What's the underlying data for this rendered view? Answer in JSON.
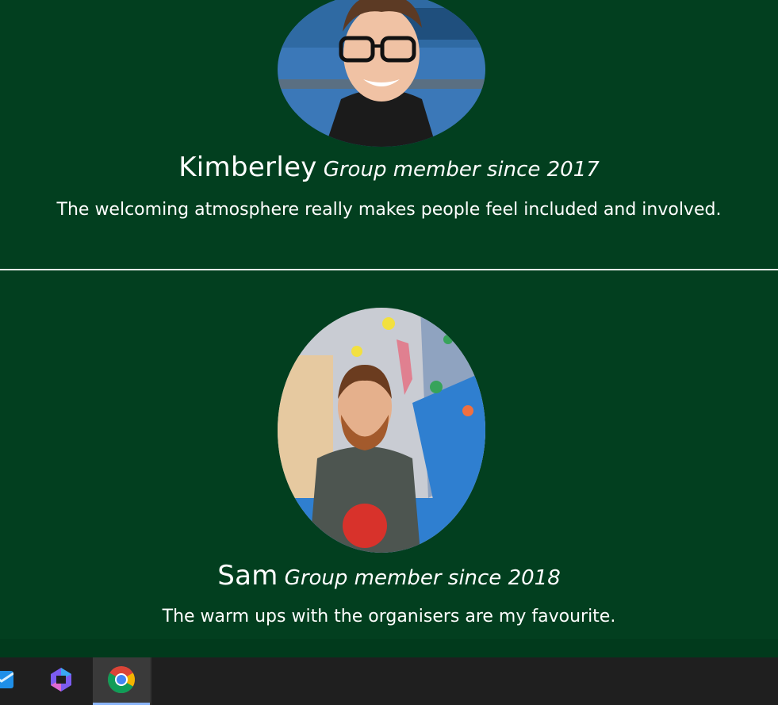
{
  "testimonials": [
    {
      "name": "Kimberley",
      "member_since": "Group member since 2017",
      "quote": "The welcoming atmosphere really makes people feel included and involved."
    },
    {
      "name": "Sam",
      "member_since": "Group member since 2018",
      "quote": "The warm ups with the organisers are my favourite."
    }
  ],
  "colors": {
    "page_background": "#023f1f",
    "text": "#ffffff",
    "divider": "#e8efe9",
    "taskbar": "#1f1f1f"
  },
  "taskbar": {
    "items": [
      {
        "icon": "mail-icon",
        "active": false
      },
      {
        "icon": "copilot-icon",
        "active": false
      },
      {
        "icon": "chrome-icon",
        "active": true
      }
    ]
  }
}
